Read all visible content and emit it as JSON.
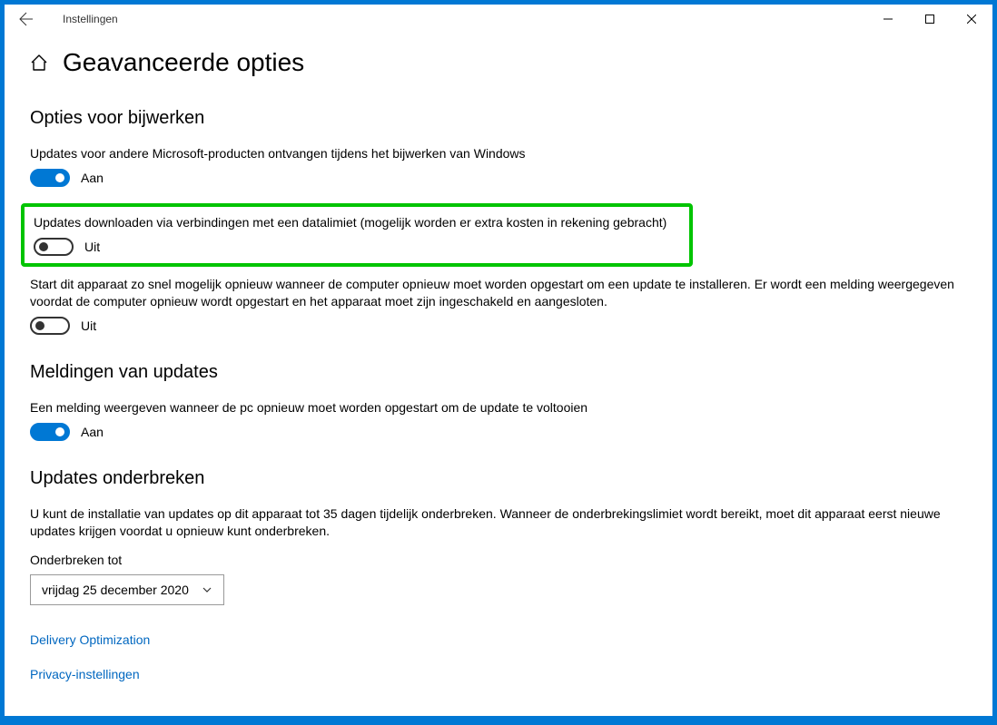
{
  "window": {
    "app_title": "Instellingen"
  },
  "page": {
    "title": "Geavanceerde opties"
  },
  "sections": {
    "update_options": {
      "heading": "Opties voor bijwerken",
      "opt1": {
        "desc": "Updates voor andere Microsoft-producten ontvangen tijdens het bijwerken van Windows",
        "state_label": "Aan"
      },
      "opt2": {
        "desc": "Updates downloaden via verbindingen met een datalimiet (mogelijk worden er extra kosten in rekening gebracht)",
        "state_label": "Uit"
      },
      "opt3": {
        "desc": "Start dit apparaat zo snel mogelijk opnieuw wanneer de computer opnieuw moet worden opgestart om een update te installeren. Er wordt een melding weergegeven voordat de computer opnieuw wordt opgestart en het apparaat moet zijn ingeschakeld en aangesloten.",
        "state_label": "Uit"
      }
    },
    "notifications": {
      "heading": "Meldingen van updates",
      "opt1": {
        "desc": "Een melding weergeven wanneer de pc opnieuw moet worden opgestart om de update te voltooien",
        "state_label": "Aan"
      }
    },
    "pause": {
      "heading": "Updates onderbreken",
      "desc": "U kunt de installatie van updates op dit apparaat tot 35 dagen tijdelijk onderbreken. Wanneer de onderbrekingslimiet wordt bereikt, moet dit apparaat eerst nieuwe updates krijgen voordat u opnieuw kunt onderbreken.",
      "label": "Onderbreken tot",
      "dropdown_value": "vrijdag 25 december 2020"
    }
  },
  "links": {
    "delivery_optimization": "Delivery Optimization",
    "privacy": "Privacy-instellingen"
  }
}
